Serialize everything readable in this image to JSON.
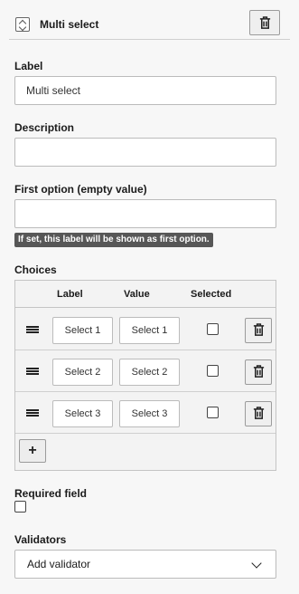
{
  "header": {
    "title": "Multi select",
    "type_icon": "select-field-icon",
    "delete_icon": "trash-icon"
  },
  "fields": {
    "label": {
      "title": "Label",
      "value": "Multi select"
    },
    "description": {
      "title": "Description",
      "value": ""
    },
    "first_option": {
      "title": "First option (empty value)",
      "value": "",
      "hint": "If set, this label will be shown as first option."
    }
  },
  "choices": {
    "title": "Choices",
    "columns": [
      "Label",
      "Value",
      "Selected"
    ],
    "rows": [
      {
        "label": "Select 1",
        "value": "Select 1",
        "selected": false
      },
      {
        "label": "Select 2",
        "value": "Select 2",
        "selected": false
      },
      {
        "label": "Select 3",
        "value": "Select 3",
        "selected": false
      }
    ],
    "add_label": "+"
  },
  "required": {
    "title": "Required field",
    "checked": false
  },
  "validators": {
    "title": "Validators",
    "selected": "Add validator"
  }
}
